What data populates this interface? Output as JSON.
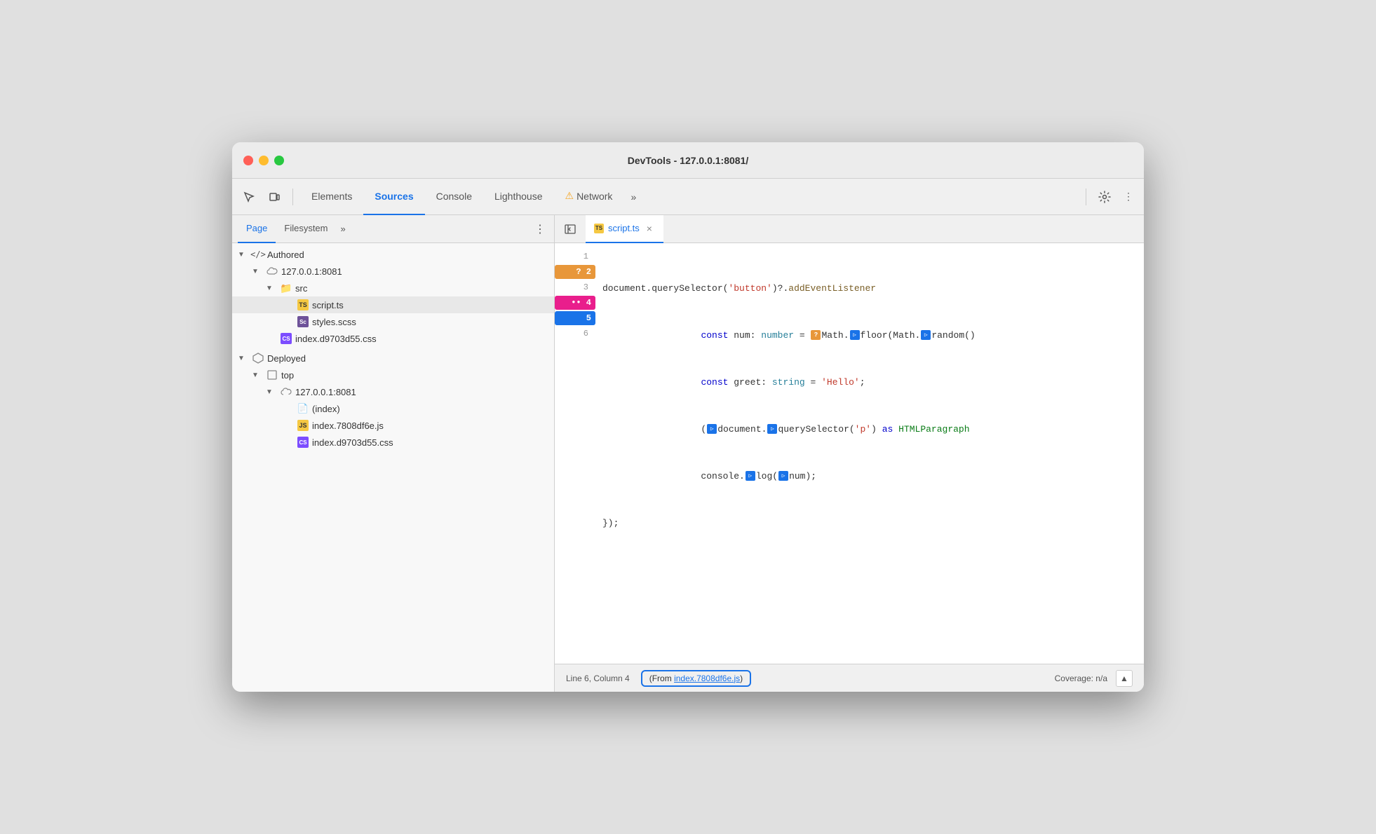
{
  "window": {
    "title": "DevTools - 127.0.0.1:8081/"
  },
  "toolbar": {
    "tabs": [
      {
        "id": "elements",
        "label": "Elements",
        "active": false,
        "warning": false
      },
      {
        "id": "sources",
        "label": "Sources",
        "active": true,
        "warning": false
      },
      {
        "id": "console",
        "label": "Console",
        "active": false,
        "warning": false
      },
      {
        "id": "lighthouse",
        "label": "Lighthouse",
        "active": false,
        "warning": false
      },
      {
        "id": "network",
        "label": "Network",
        "active": false,
        "warning": true
      }
    ],
    "more_tabs": "»",
    "settings_label": "⚙",
    "more_menu": "⋮"
  },
  "left_panel": {
    "sub_tabs": [
      {
        "id": "page",
        "label": "Page",
        "active": true
      },
      {
        "id": "filesystem",
        "label": "Filesystem",
        "active": false
      }
    ],
    "sub_more": "»",
    "tree": [
      {
        "id": "authored",
        "indent": 0,
        "arrow": "▼",
        "icon": "authored",
        "label": "Authored",
        "type": "group"
      },
      {
        "id": "server-authored",
        "indent": 1,
        "arrow": "▼",
        "icon": "cloud",
        "label": "127.0.0.1:8081",
        "type": "server"
      },
      {
        "id": "src",
        "indent": 2,
        "arrow": "▼",
        "icon": "folder",
        "label": "src",
        "type": "folder"
      },
      {
        "id": "script-ts",
        "indent": 3,
        "arrow": "",
        "icon": "ts",
        "label": "script.ts",
        "type": "file",
        "selected": true
      },
      {
        "id": "styles-scss",
        "indent": 3,
        "arrow": "",
        "icon": "scss",
        "label": "styles.scss",
        "type": "file"
      },
      {
        "id": "index-css",
        "indent": 2,
        "arrow": "",
        "icon": "css-purple",
        "label": "index.d9703d55.css",
        "type": "file"
      },
      {
        "id": "deployed",
        "indent": 0,
        "arrow": "▼",
        "icon": "box",
        "label": "Deployed",
        "type": "group"
      },
      {
        "id": "top",
        "indent": 1,
        "arrow": "▼",
        "icon": "box-outline",
        "label": "top",
        "type": "folder"
      },
      {
        "id": "server-deployed",
        "indent": 2,
        "arrow": "▼",
        "icon": "cloud",
        "label": "127.0.0.1:8081",
        "type": "server"
      },
      {
        "id": "index-page",
        "indent": 3,
        "arrow": "",
        "icon": "generic",
        "label": "(index)",
        "type": "file"
      },
      {
        "id": "index-js",
        "indent": 3,
        "arrow": "",
        "icon": "js",
        "label": "index.7808df6e.js",
        "type": "file"
      },
      {
        "id": "index-css2",
        "indent": 3,
        "arrow": "",
        "icon": "css-purple",
        "label": "index.d9703d55.css",
        "type": "file"
      }
    ]
  },
  "editor": {
    "sidebar_toggle": "◀",
    "open_tab": {
      "icon": "ts",
      "label": "script.ts",
      "close": "×"
    },
    "lines": [
      {
        "num": 1,
        "badge": null,
        "code": "document.querySelector('button')?.addEventListener"
      },
      {
        "num": 2,
        "badge": "orange",
        "badge_dots": "?",
        "code_parts": [
          {
            "text": "    ",
            "class": ""
          },
          {
            "text": "const",
            "class": "c-blue-keyword"
          },
          {
            "text": " num",
            "class": ""
          },
          {
            "text": ": ",
            "class": ""
          },
          {
            "text": "number",
            "class": "c-teal"
          },
          {
            "text": " = ",
            "class": ""
          },
          {
            "text": "?",
            "class": "type-question-inline"
          },
          {
            "text": "Math",
            "class": ""
          },
          {
            "text": ".",
            "class": ""
          },
          {
            "text": "▷",
            "class": "type-arrow-inline"
          },
          {
            "text": "floor(Math.",
            "class": ""
          },
          {
            "text": "▷",
            "class": "type-arrow-inline"
          },
          {
            "text": "random()",
            "class": ""
          }
        ]
      },
      {
        "num": 3,
        "badge": null,
        "code_parts": [
          {
            "text": "    ",
            "class": ""
          },
          {
            "text": "const",
            "class": "c-blue-keyword"
          },
          {
            "text": " greet",
            "class": ""
          },
          {
            "text": ": ",
            "class": ""
          },
          {
            "text": "string",
            "class": "c-teal"
          },
          {
            "text": " = ",
            "class": ""
          },
          {
            "text": "'Hello'",
            "class": "c-string"
          },
          {
            "text": ";",
            "class": ""
          }
        ]
      },
      {
        "num": 4,
        "badge": "pink",
        "badge_dots": "••",
        "code_parts": [
          {
            "text": "    (",
            "class": ""
          },
          {
            "text": "▷",
            "class": "type-arrow-inline"
          },
          {
            "text": "document.",
            "class": ""
          },
          {
            "text": "▷",
            "class": "type-arrow-inline"
          },
          {
            "text": "querySelector(",
            "class": ""
          },
          {
            "text": "'p'",
            "class": "c-string"
          },
          {
            "text": ") ",
            "class": ""
          },
          {
            "text": "as",
            "class": "c-blue-keyword"
          },
          {
            "text": " HTMLParagraph",
            "class": "c-html-type"
          }
        ]
      },
      {
        "num": 5,
        "badge": "blue",
        "badge_dots": "",
        "code_parts": [
          {
            "text": "    console.",
            "class": ""
          },
          {
            "text": "▷",
            "class": "type-arrow-inline"
          },
          {
            "text": "log(",
            "class": ""
          },
          {
            "text": "▷",
            "class": "type-arrow-inline"
          },
          {
            "text": "num);",
            "class": ""
          }
        ]
      },
      {
        "num": 6,
        "badge": null,
        "code_parts": [
          {
            "text": "});",
            "class": ""
          }
        ]
      }
    ]
  },
  "status_bar": {
    "position": "Line 6, Column 4",
    "from_label": "(From ",
    "from_link": "index.7808df6e.js",
    "from_close": ")",
    "coverage": "Coverage: n/a",
    "coverage_icon": "▲"
  }
}
